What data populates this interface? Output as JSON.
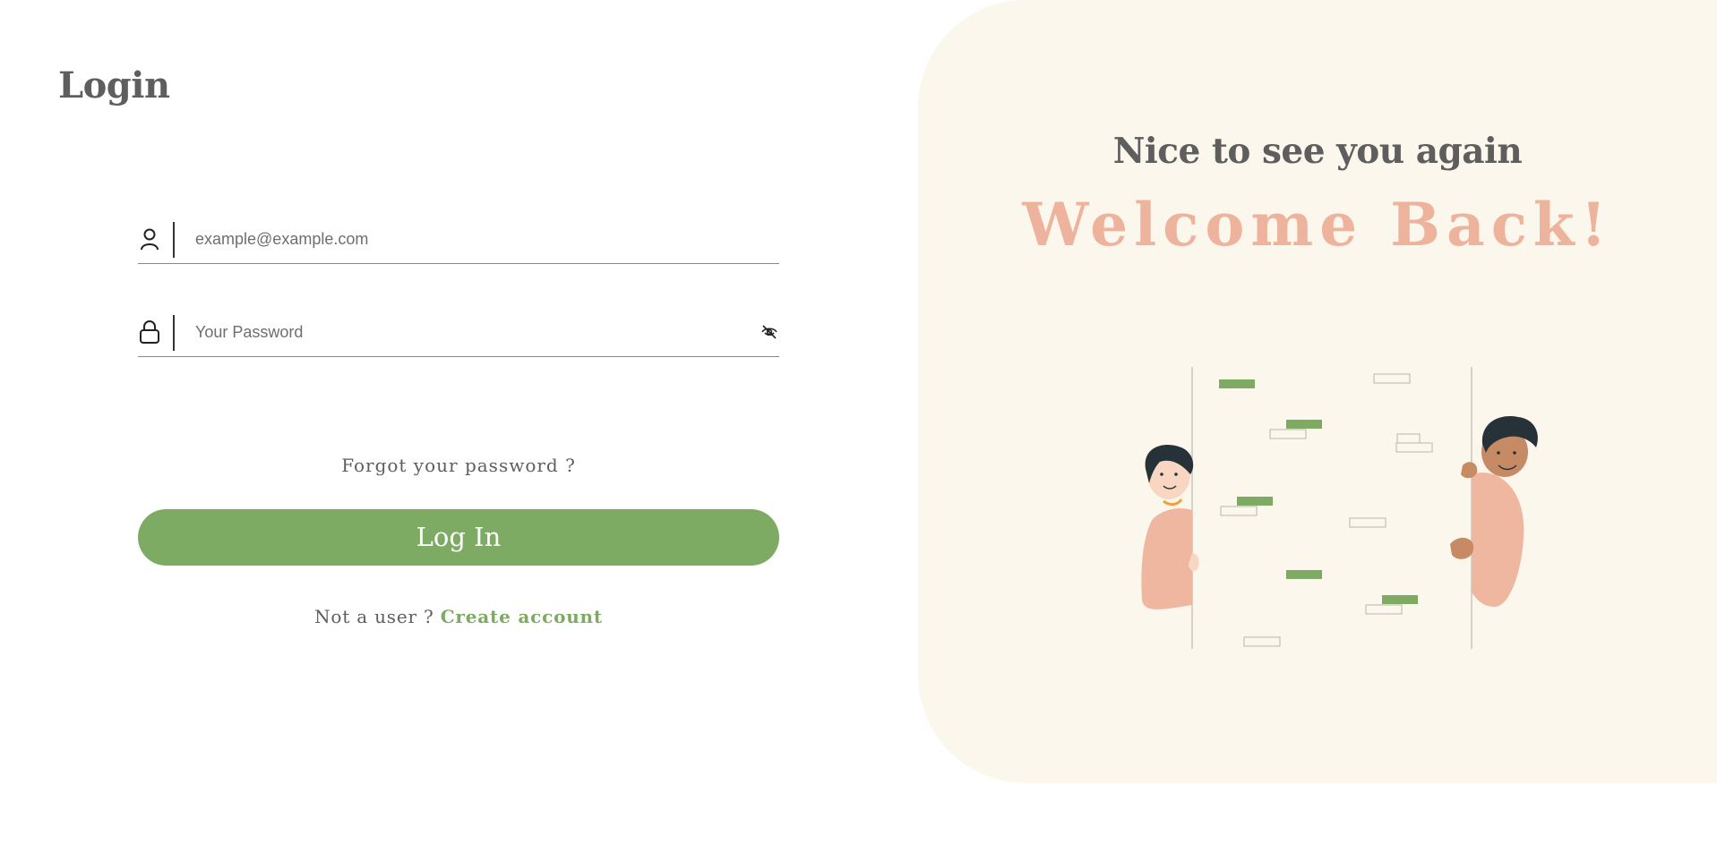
{
  "page": {
    "title": "Login"
  },
  "form": {
    "email": {
      "placeholder": "example@example.com",
      "value": ""
    },
    "password": {
      "placeholder": "Your Password",
      "value": ""
    },
    "forgot_password": "Forgot your password ?",
    "login_button": "Log In",
    "signup_prompt": "Not a user ?",
    "create_account": "Create account"
  },
  "hero": {
    "greeting": "Nice to see you again",
    "headline": "Welcome Back!"
  },
  "icons": {
    "email": "user-icon",
    "password": "lock-icon",
    "toggle_visibility": "eye-off-icon"
  },
  "colors": {
    "accent_green": "#7dab64",
    "welcome_peach": "#eeb39c",
    "panel_background": "#fcf7ec",
    "text_gray": "#5e5e5e"
  }
}
